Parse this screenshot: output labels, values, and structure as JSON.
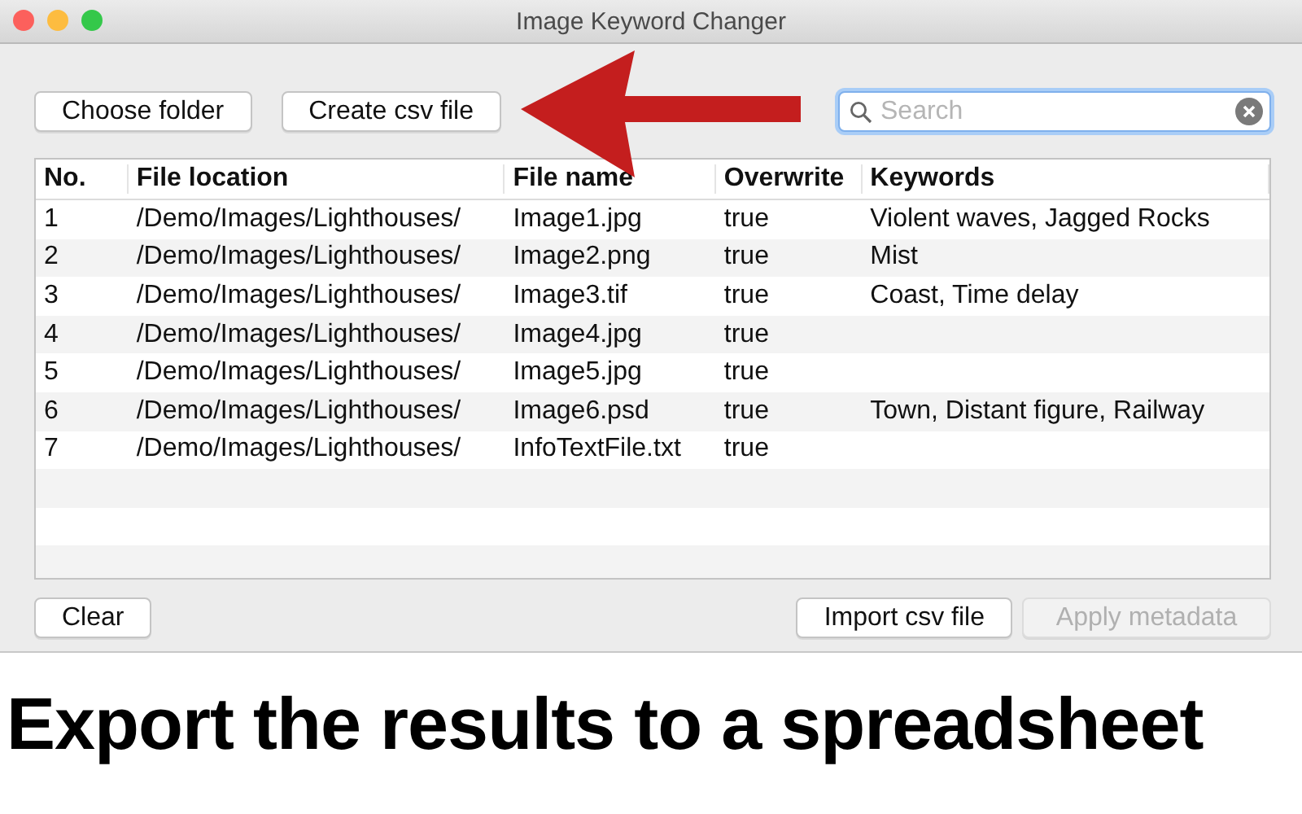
{
  "window": {
    "title": "Image Keyword Changer"
  },
  "toolbar": {
    "buttons": [
      {
        "label": "Choose folder",
        "disabled": false
      },
      {
        "label": "Create csv file",
        "disabled": false
      }
    ],
    "search": {
      "placeholder": "Search"
    }
  },
  "table": {
    "columns": [
      "No.",
      "File location",
      "File name",
      "Overwrite",
      "Keywords"
    ],
    "rows": [
      [
        "1",
        "/Demo/Images/Lighthouses/",
        "Image1.jpg",
        "true",
        "Violent waves, Jagged Rocks"
      ],
      [
        "2",
        "/Demo/Images/Lighthouses/",
        "Image2.png",
        "true",
        "Mist"
      ],
      [
        "3",
        "/Demo/Images/Lighthouses/",
        "Image3.tif",
        "true",
        "Coast, Time delay"
      ],
      [
        "4",
        "/Demo/Images/Lighthouses/",
        "Image4.jpg",
        "true",
        ""
      ],
      [
        "5",
        "/Demo/Images/Lighthouses/",
        "Image5.jpg",
        "true",
        ""
      ],
      [
        "6",
        "/Demo/Images/Lighthouses/",
        "Image6.psd",
        "true",
        "Town, Distant figure, Railway"
      ],
      [
        "7",
        "/Demo/Images/Lighthouses/",
        "InfoTextFile.txt",
        "true",
        ""
      ]
    ]
  },
  "bottom_buttons": [
    {
      "label": "Clear",
      "disabled": false
    },
    {
      "label": "Import csv file",
      "disabled": false
    },
    {
      "label": "Apply metadata",
      "disabled": true
    }
  ],
  "caption": "Export the results to a spreadsheet"
}
